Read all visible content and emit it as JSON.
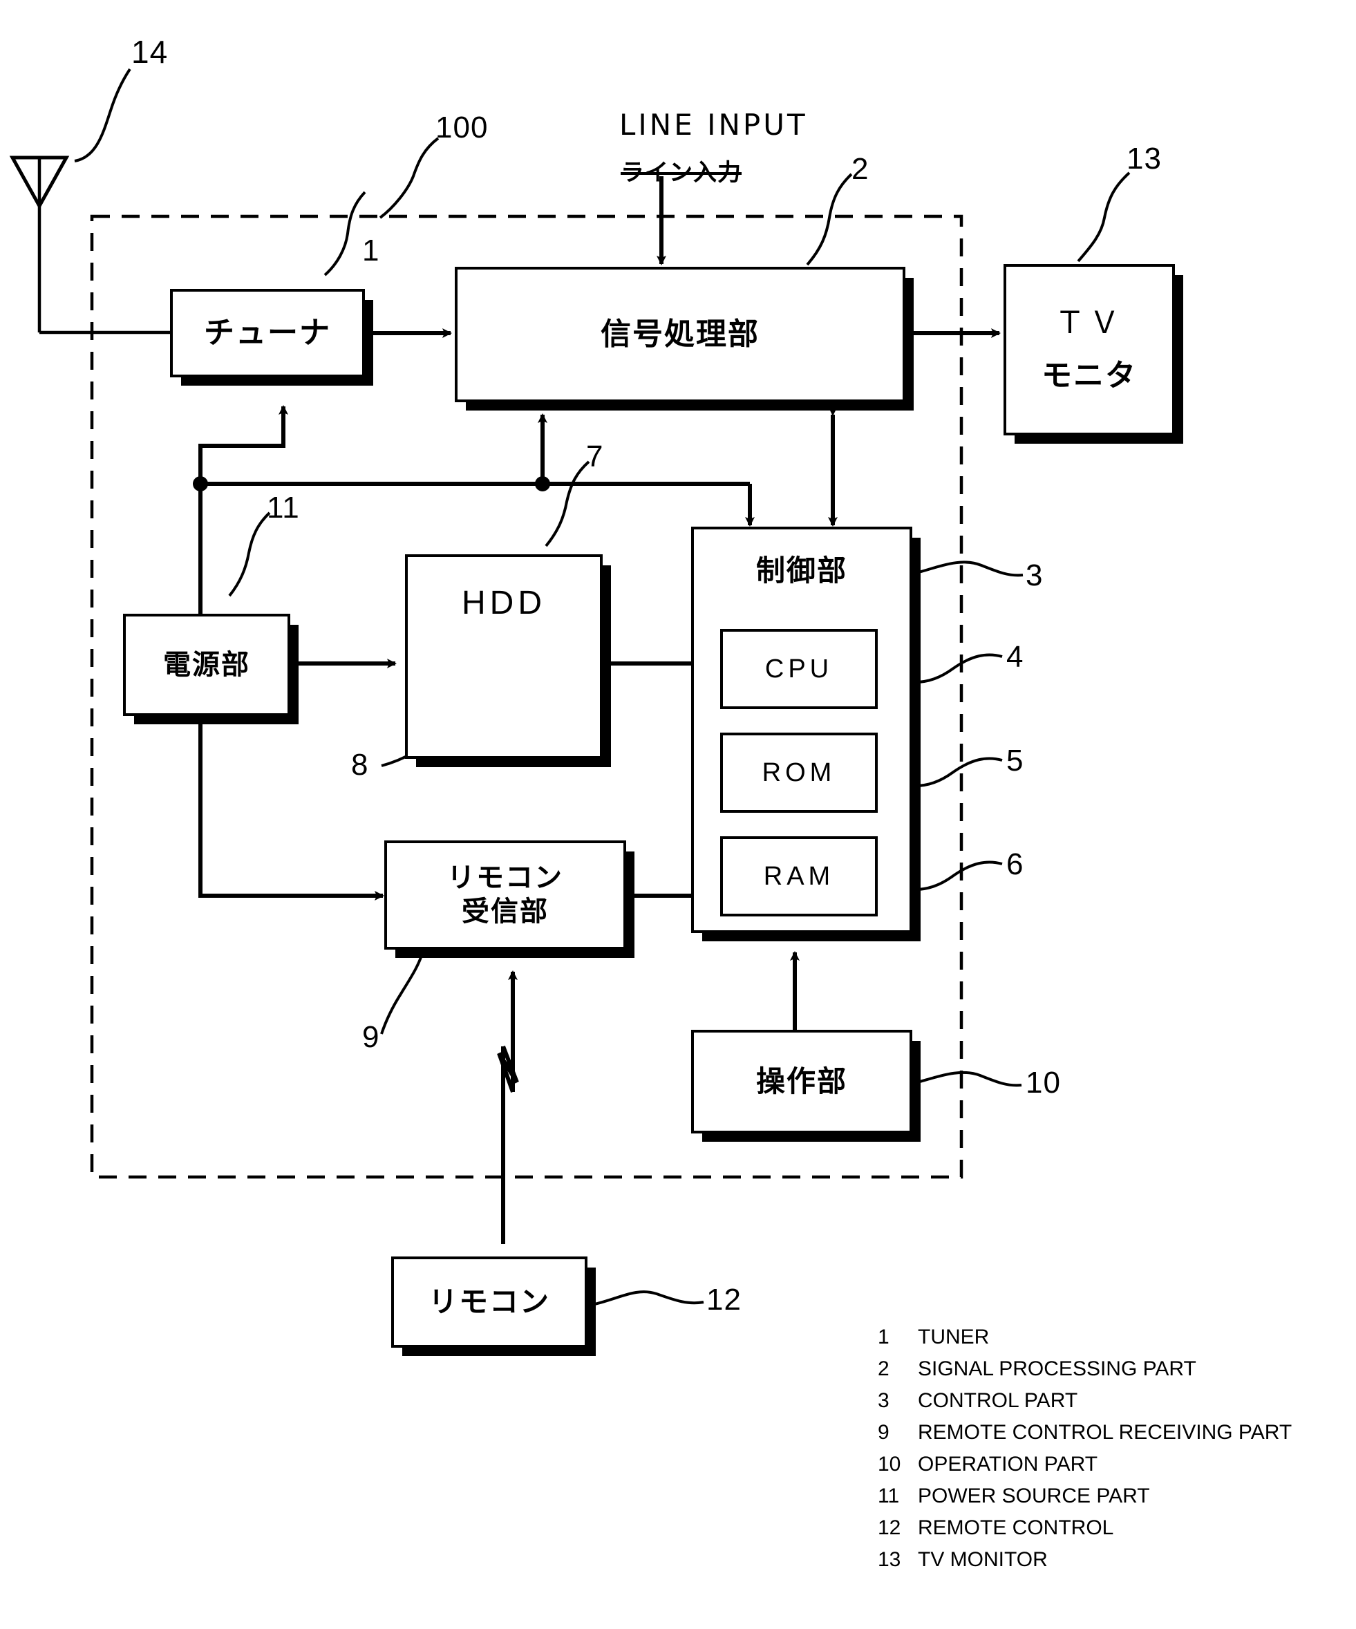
{
  "figure": {
    "unit_ref": "100",
    "antenna_ref": "14",
    "line_input_annotation_en": "LINE INPUT",
    "line_input_annotation_jp": "ライン入力"
  },
  "blocks": {
    "tuner": {
      "ref": "1",
      "label": "チューナ",
      "en": "TUNER"
    },
    "signal": {
      "ref": "2",
      "label": "信号処理部",
      "en": "SIGNAL PROCESSING PART"
    },
    "control": {
      "ref": "3",
      "label": "制御部",
      "en": "CONTROL PART"
    },
    "cpu": {
      "ref": "4",
      "label": "CPU"
    },
    "rom": {
      "ref": "5",
      "label": "ROM"
    },
    "ram": {
      "ref": "6",
      "label": "RAM"
    },
    "hdd": {
      "ref": "7",
      "label": "HDD"
    },
    "disk": {
      "ref": "8",
      "label": ""
    },
    "remote_rx": {
      "ref": "9",
      "label_line1": "リモコン",
      "label_line2": "受信部",
      "en": "REMOTE CONTROL RECEIVING PART"
    },
    "operation": {
      "ref": "10",
      "label": "操作部",
      "en": "OPERATION PART"
    },
    "power": {
      "ref": "11",
      "label": "電源部",
      "en": "POWER SOURCE PART"
    },
    "remote": {
      "ref": "12",
      "label": "リモコン",
      "en": "REMOTE CONTROL"
    },
    "tv_monitor": {
      "ref": "13",
      "label_line1": "ＴＶ",
      "label_line2": "モニタ",
      "en": "TV MONITOR"
    }
  },
  "legend": {
    "entries": [
      {
        "num": "1",
        "text": "TUNER"
      },
      {
        "num": "2",
        "text": "SIGNAL PROCESSING PART"
      },
      {
        "num": "3",
        "text": "CONTROL PART"
      },
      {
        "num": "9",
        "text": "REMOTE CONTROL RECEIVING PART"
      },
      {
        "num": "10",
        "text": "OPERATION PART"
      },
      {
        "num": "11",
        "text": "POWER SOURCE PART"
      },
      {
        "num": "12",
        "text": "REMOTE CONTROL"
      },
      {
        "num": "13",
        "text": "TV MONITOR"
      }
    ]
  },
  "colors": {
    "ink": "#000000",
    "paper": "#ffffff"
  }
}
